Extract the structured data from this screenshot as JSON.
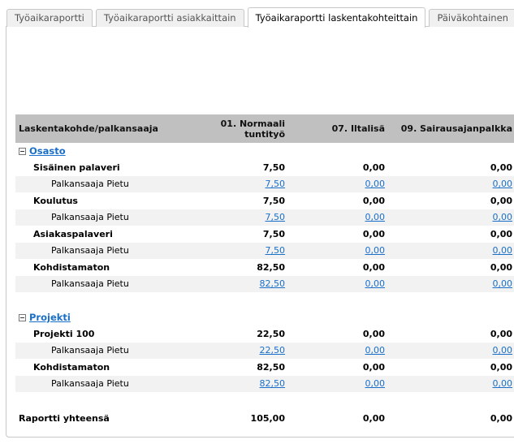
{
  "tabs": [
    "Työaikaraportti",
    "Työaikaraportti asiakkaittain",
    "Työaikaraportti laskentakohteittain",
    "Päiväkohtainen"
  ],
  "active_tab": 2,
  "columns": [
    "Laskentakohde/palkansaaja",
    "01. Normaali tuntityö",
    "07. Iltalisä",
    "09. Sairausajanpalkka"
  ],
  "groups": [
    {
      "name": "Osasto",
      "items": [
        {
          "name": "Sisäinen palaveri",
          "values": [
            "7,50",
            "0,00",
            "0,00"
          ],
          "sub": {
            "name": "Palkansaaja Pietu",
            "values": [
              "7,50",
              "0,00",
              "0,00"
            ]
          }
        },
        {
          "name": "Koulutus",
          "values": [
            "7,50",
            "0,00",
            "0,00"
          ],
          "sub": {
            "name": "Palkansaaja Pietu",
            "values": [
              "7,50",
              "0,00",
              "0,00"
            ]
          }
        },
        {
          "name": "Asiakaspalaveri",
          "values": [
            "7,50",
            "0,00",
            "0,00"
          ],
          "sub": {
            "name": "Palkansaaja Pietu",
            "values": [
              "7,50",
              "0,00",
              "0,00"
            ]
          }
        },
        {
          "name": "Kohdistamaton",
          "values": [
            "82,50",
            "0,00",
            "0,00"
          ],
          "sub": {
            "name": "Palkansaaja Pietu",
            "values": [
              "82,50",
              "0,00",
              "0,00"
            ]
          }
        }
      ]
    },
    {
      "name": "Projekti",
      "items": [
        {
          "name": "Projekti 100",
          "values": [
            "22,50",
            "0,00",
            "0,00"
          ],
          "sub": {
            "name": "Palkansaaja Pietu",
            "values": [
              "22,50",
              "0,00",
              "0,00"
            ]
          }
        },
        {
          "name": "Kohdistamaton",
          "values": [
            "82,50",
            "0,00",
            "0,00"
          ],
          "sub": {
            "name": "Palkansaaja Pietu",
            "values": [
              "82,50",
              "0,00",
              "0,00"
            ]
          }
        }
      ]
    }
  ],
  "total": {
    "label": "Raportti yhteensä",
    "values": [
      "105,00",
      "0,00",
      "0,00"
    ]
  }
}
